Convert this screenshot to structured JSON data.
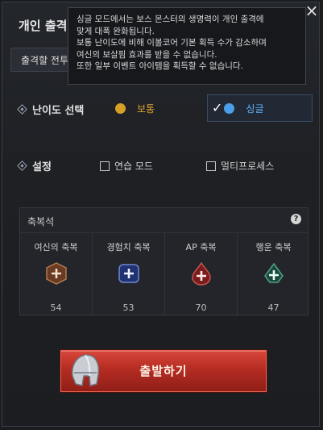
{
  "window": {
    "title": "개인 출격",
    "close_icon": "×"
  },
  "subtab": {
    "label": "출격할 전투"
  },
  "tooltip": {
    "lines": [
      "싱글 모드에서는 보스 몬스터의 생명력이 개인 출격에",
      "맞게 대폭 완화됩니다.",
      "보통 난이도에 비해 이볼코어 기본 획득 수가 감소하며",
      "여신의 보살핌 효과를 받을 수 없습니다.",
      "또한 일부 이벤트 아이템을 획득할 수 없습니다."
    ]
  },
  "difficulty": {
    "label": "난이도 선택",
    "options": [
      {
        "label": "보통",
        "selected": false,
        "color": "#e0a530"
      },
      {
        "label": "싱글",
        "selected": true,
        "color": "#5fb6ff"
      }
    ]
  },
  "settings": {
    "label": "설정",
    "options": [
      {
        "label": "연습 모드",
        "checked": false
      },
      {
        "label": "멀티프로세스",
        "checked": false
      }
    ]
  },
  "blessing": {
    "title": "축복석",
    "help_icon": "?",
    "items": [
      {
        "name": "여신의 축복",
        "value": "54",
        "color": "#8a4a2a",
        "icon": "plus-shield-brown-icon"
      },
      {
        "name": "경험치 축복",
        "value": "53",
        "color": "#2c3f8a",
        "icon": "plus-shield-blue-icon"
      },
      {
        "name": "AP 축복",
        "value": "70",
        "color": "#8a2020",
        "icon": "plus-drop-red-icon"
      },
      {
        "name": "행운 축복",
        "value": "47",
        "color": "#1f5a45",
        "icon": "plus-clover-green-icon"
      }
    ]
  },
  "start_button": {
    "label": "출발하기",
    "icon": "helmet-icon"
  },
  "colors": {
    "accent_red": "#b52c22",
    "selected_blue": "#5fb6ff",
    "normal_gold": "#e0a530"
  }
}
